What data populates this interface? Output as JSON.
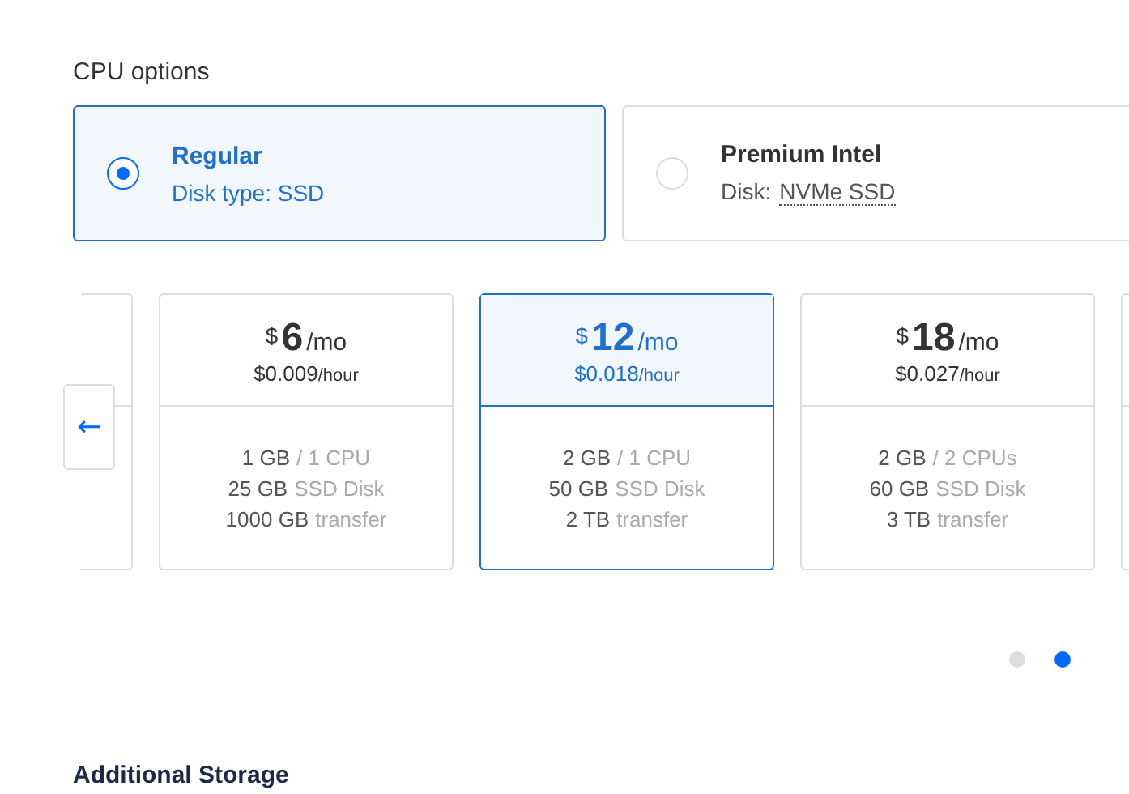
{
  "cpu_options": {
    "title": "CPU options",
    "options": [
      {
        "name": "Regular",
        "detail_label": "Disk type: SSD",
        "selected": true
      },
      {
        "name": "Premium Intel",
        "detail_label": "Disk:",
        "detail_value": "NVMe SSD",
        "selected": false
      }
    ]
  },
  "plans": {
    "back_button": "←",
    "cards": [
      {
        "currency": "$",
        "amount": "6",
        "period": "/mo",
        "hourly": "$0.009",
        "hourly_unit": "/hour",
        "selected": false,
        "specs": [
          {
            "value": "1 GB",
            "unit": "/ 1 CPU"
          },
          {
            "value": "25 GB",
            "unit": "SSD Disk"
          },
          {
            "value": "1000 GB",
            "unit": "transfer"
          }
        ]
      },
      {
        "currency": "$",
        "amount": "12",
        "period": "/mo",
        "hourly": "$0.018",
        "hourly_unit": "/hour",
        "selected": true,
        "specs": [
          {
            "value": "2 GB",
            "unit": "/ 1 CPU"
          },
          {
            "value": "50 GB",
            "unit": "SSD Disk"
          },
          {
            "value": "2 TB",
            "unit": "transfer"
          }
        ]
      },
      {
        "currency": "$",
        "amount": "18",
        "period": "/mo",
        "hourly": "$0.027",
        "hourly_unit": "/hour",
        "selected": false,
        "specs": [
          {
            "value": "2 GB",
            "unit": "/ 2 CPUs"
          },
          {
            "value": "60 GB",
            "unit": "SSD Disk"
          },
          {
            "value": "3 TB",
            "unit": "transfer"
          }
        ]
      }
    ],
    "pages": [
      {
        "selected": false
      },
      {
        "selected": true
      }
    ]
  },
  "additional_storage": {
    "title": "Additional Storage"
  }
}
